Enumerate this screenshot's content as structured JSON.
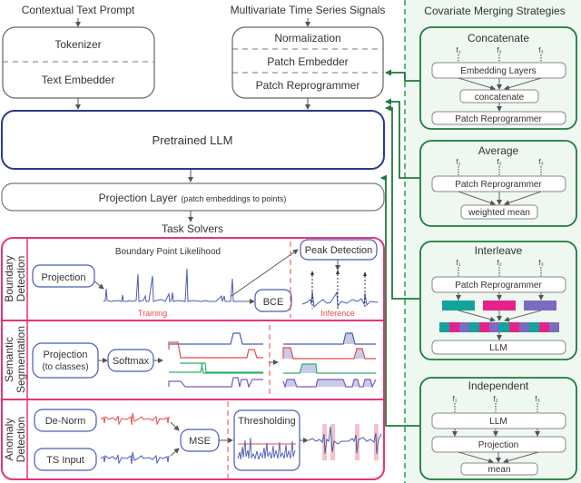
{
  "inputs": {
    "text_prompt": "Contextual Text Prompt",
    "ts_signals": "Multivariate Time Series Signals"
  },
  "text_stack": [
    "Tokenizer",
    "Text Embedder"
  ],
  "ts_stack": [
    "Normalization",
    "Patch Embedder",
    "Patch Reprogrammer"
  ],
  "llm": "Pretrained LLM",
  "projection": {
    "label": "Projection Layer",
    "note": "(patch embeddings to points)"
  },
  "task_solvers_title": "Task Solvers",
  "tasks": {
    "boundary": {
      "label_line1": "Boundary",
      "label_line2": "Detection",
      "projection": "Projection",
      "likelihood_title": "Boundary Point Likelihood",
      "bce": "BCE",
      "peak_detection": "Peak Detection",
      "training": "Training",
      "inference": "Inference"
    },
    "segmentation": {
      "label_line1": "Semantic",
      "label_line2": "Segmentation",
      "projection_line1": "Projection",
      "projection_line2": "(to classes)",
      "softmax": "Softmax"
    },
    "anomaly": {
      "label_line1": "Anomaly",
      "label_line2": "Detection",
      "denorm": "De-Norm",
      "ts_input": "TS Input",
      "mse": "MSE",
      "thresholding": "Thresholding"
    }
  },
  "covariate": {
    "title": "Covariate Merging Strategies",
    "features": [
      "f₁",
      "f₂",
      "f₃"
    ],
    "strategies": [
      {
        "name": "Concatenate",
        "steps": [
          "Embedding Layers",
          "concatenate",
          "Patch Reprogrammer"
        ]
      },
      {
        "name": "Average",
        "steps": [
          "Patch Reprogrammer",
          "weighted mean"
        ]
      },
      {
        "name": "Interleave",
        "steps": [
          "Patch Reprogrammer",
          "LLM"
        ]
      },
      {
        "name": "Independent",
        "steps": [
          "LLM",
          "Projection",
          "mean"
        ]
      }
    ]
  },
  "colors": {
    "llm_border": "#2b3a8f",
    "task_border": "#e8337a",
    "green": "#1e7a3c",
    "green_panel_bg": "#eef8f1",
    "teal": "#12a39a",
    "magenta": "#e5228a",
    "purple": "#7a6cc0",
    "blue_line": "#4a5bb5",
    "red_line": "#e84a4a",
    "green_line": "#2cae6e",
    "violet_line": "#7b5bbf"
  }
}
